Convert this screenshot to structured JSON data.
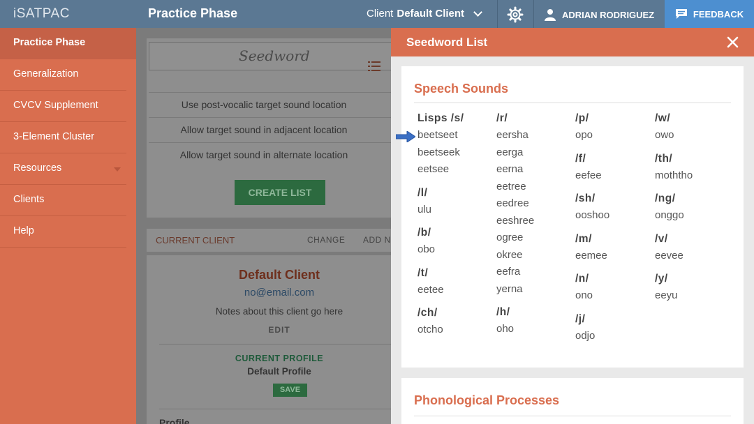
{
  "topbar": {
    "logo": "iSATPAC",
    "title": "Practice Phase",
    "client_prefix": "Client",
    "client_name": "Default Client",
    "user_name": "ADRIAN RODRIGUEZ",
    "feedback_label": "FEEDBACK"
  },
  "sidebar": {
    "items": [
      {
        "label": "Practice Phase"
      },
      {
        "label": "Generalization"
      },
      {
        "label": "CVCV Supplement"
      },
      {
        "label": "3-Element Cluster"
      },
      {
        "label": "Resources"
      },
      {
        "label": "Clients"
      },
      {
        "label": "Help"
      }
    ]
  },
  "main": {
    "seedword_placeholder": "Seedword",
    "options": [
      "Use post-vocalic target sound location",
      "Allow target sound in adjacent location",
      "Allow target sound in alternate location"
    ],
    "create_list_label": "CREATE LIST",
    "current_client_label": "CURRENT CLIENT",
    "change_label": "CHANGE",
    "add_new_label": "ADD N",
    "client_name": "Default Client",
    "client_email": "no@email.com",
    "client_notes": "Notes about this client go here",
    "edit_label": "EDIT",
    "current_profile_label": "CURRENT PROFILE",
    "profile_name": "Default Profile",
    "save_label": "SAVE",
    "profile_section_label": "Profile"
  },
  "panel": {
    "title": "Seedword List",
    "speech_sounds_title": "Speech Sounds",
    "phonological_title": "Phonological Processes",
    "columns": [
      [
        {
          "h": "Lisps /s/",
          "w": [
            "beetseet",
            "beetseek",
            "eetsee"
          ]
        },
        {
          "h": "/l/",
          "w": [
            "ulu"
          ]
        },
        {
          "h": "/b/",
          "w": [
            "obo"
          ]
        },
        {
          "h": "/t/",
          "w": [
            "eetee"
          ]
        },
        {
          "h": "/ch/",
          "w": [
            "otcho"
          ]
        }
      ],
      [
        {
          "h": "/r/",
          "w": [
            "eersha",
            "eerga",
            "eerna",
            "eetree",
            "eedree",
            "eeshree",
            "ogree",
            "okree",
            "eefra",
            "yerna"
          ]
        },
        {
          "h": "/h/",
          "w": [
            "oho"
          ]
        }
      ],
      [
        {
          "h": "/p/",
          "w": [
            "opo"
          ]
        },
        {
          "h": "/f/",
          "w": [
            "eefee"
          ]
        },
        {
          "h": "/sh/",
          "w": [
            "ooshoo"
          ]
        },
        {
          "h": "/m/",
          "w": [
            "eemee"
          ]
        },
        {
          "h": "/n/",
          "w": [
            "ono"
          ]
        },
        {
          "h": "/j/",
          "w": [
            "odjo"
          ]
        }
      ],
      [
        {
          "h": "/w/",
          "w": [
            "owo"
          ]
        },
        {
          "h": "/th/",
          "w": [
            "moththo"
          ]
        },
        {
          "h": "/ng/",
          "w": [
            "onggo"
          ]
        },
        {
          "h": "/v/",
          "w": [
            "eevee"
          ]
        },
        {
          "h": "/y/",
          "w": [
            "eeyu"
          ]
        }
      ]
    ]
  },
  "colors": {
    "topbar": "#5b7893",
    "accent": "#d96e4f",
    "feedback": "#4d8fd0",
    "pointer_arrow": "#3b6fc4"
  }
}
